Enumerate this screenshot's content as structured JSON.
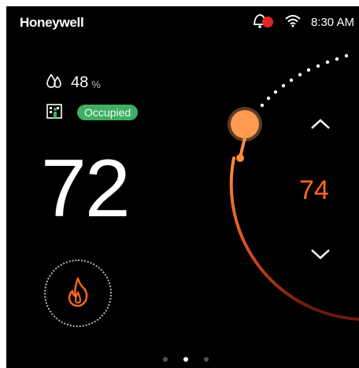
{
  "header": {
    "brand": "Honeywell",
    "time": "8:30 AM"
  },
  "status_icons": [
    "alert-bell-icon",
    "wifi-icon"
  ],
  "humidity": {
    "value": "48",
    "unit": "%",
    "icon": "humidity-drops-icon"
  },
  "occupancy": {
    "icon": "building-person-icon",
    "label": "Occupied"
  },
  "indoor_temperature": "72",
  "setpoint": "74",
  "mode": {
    "icon": "flame-icon"
  },
  "pager": {
    "count": 3,
    "active_index": 1
  },
  "colors": {
    "accent": "#ff6a1f",
    "occupied": "#3fae64",
    "background": "#000000"
  }
}
